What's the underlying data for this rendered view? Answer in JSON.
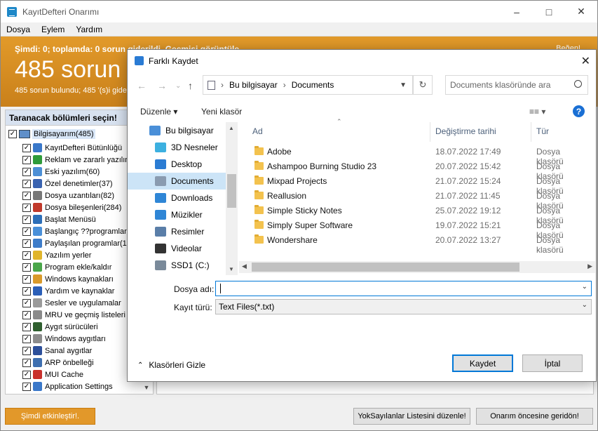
{
  "app": {
    "title": "KayıtDefteri Onarımı",
    "menu": [
      "Dosya",
      "Eylem",
      "Yardım"
    ],
    "banner": {
      "status_line": "Şimdi: 0; toplamda: 0 sorun giderildi. Geçmişi görüntüle",
      "big_text": "485 sorun",
      "sub_text": "485 sorun bulundu; 485 '(s)i gider",
      "like": "Beğen!"
    },
    "left_panel": {
      "heading": "Taranacak bölümleri seçin!",
      "root": "Bilgisayarım(485)",
      "items": [
        {
          "label": "KayıtDefteri Bütünlüğü",
          "color": "#3a78c9"
        },
        {
          "label": "Reklam ve zararlı yazılıml",
          "color": "#2e9b3a"
        },
        {
          "label": "Eski yazılım(60)",
          "color": "#4c8fd6"
        },
        {
          "label": "Özel denetimler(37)",
          "color": "#3a63b0"
        },
        {
          "label": "Dosya uzantıları(82)",
          "color": "#777777"
        },
        {
          "label": "Dosya bileşenleri(284)",
          "color": "#c0392b"
        },
        {
          "label": "Başlat Menüsü",
          "color": "#2d6fb8"
        },
        {
          "label": "Başlangıç ??programları(8",
          "color": "#4a90d9"
        },
        {
          "label": "Paylaşılan programlar(14",
          "color": "#3d7cc9"
        },
        {
          "label": "Yazılım yerler",
          "color": "#e0b52c"
        },
        {
          "label": "Program ekle/kaldır",
          "color": "#4aa64a"
        },
        {
          "label": "Windows kaynakları",
          "color": "#d99a2b"
        },
        {
          "label": "Yardım ve kaynaklar",
          "color": "#2b5fb8"
        },
        {
          "label": "Sesler ve uygulamalar",
          "color": "#9a9a9a"
        },
        {
          "label": "MRU ve geçmiş listeleri",
          "color": "#8a8a8a"
        },
        {
          "label": "Aygıt sürücüleri",
          "color": "#2f5f2f"
        },
        {
          "label": "Windows aygıtları",
          "color": "#8c8c8c"
        },
        {
          "label": "Sanal aygıtlar",
          "color": "#2c4f9a"
        },
        {
          "label": "ARP önbelleği",
          "color": "#3e6fb0"
        },
        {
          "label": "MUI Cache",
          "color": "#c9302c"
        },
        {
          "label": "Application Settings",
          "color": "#3a78c9"
        }
      ]
    },
    "buttons": {
      "fix_now": "Şimdi etkinleştir!.",
      "ignore_list": "YokSayılanlar Listesini düzenle!",
      "restore": "Onarım öncesine geridön!"
    }
  },
  "dialog": {
    "title": "Farklı Kaydet",
    "address": [
      "Bu bilgisayar",
      "Documents"
    ],
    "search_placeholder": "Documents klasöründe ara",
    "organize": "Düzenle",
    "new_folder": "Yeni klasör",
    "nav_items": [
      {
        "label": "Bu bilgisayar",
        "color": "#4a8fd8",
        "selected": false
      },
      {
        "label": "3D Nesneler",
        "color": "#3cb0e0",
        "selected": false
      },
      {
        "label": "Desktop",
        "color": "#2b7cd3",
        "selected": false
      },
      {
        "label": "Documents",
        "color": "#8a9bb0",
        "selected": true
      },
      {
        "label": "Downloads",
        "color": "#2f86d6",
        "selected": false
      },
      {
        "label": "Müzikler",
        "color": "#2f86d6",
        "selected": false
      },
      {
        "label": "Resimler",
        "color": "#5a7ea8",
        "selected": false
      },
      {
        "label": "Videolar",
        "color": "#333333",
        "selected": false
      },
      {
        "label": "SSD1 (C:)",
        "color": "#7a8a9a",
        "selected": false
      }
    ],
    "columns": {
      "name": "Ad",
      "date": "Değiştirme tarihi",
      "type": "Tür"
    },
    "files": [
      {
        "name": "Adobe",
        "date": "18.07.2022 17:49",
        "type": "Dosya klasörü"
      },
      {
        "name": "Ashampoo Burning Studio 23",
        "date": "20.07.2022 15:42",
        "type": "Dosya klasörü"
      },
      {
        "name": "Mixpad Projects",
        "date": "21.07.2022 15:24",
        "type": "Dosya klasörü"
      },
      {
        "name": "Reallusion",
        "date": "21.07.2022 11:45",
        "type": "Dosya klasörü"
      },
      {
        "name": "Simple Sticky Notes",
        "date": "25.07.2022 19:12",
        "type": "Dosya klasörü"
      },
      {
        "name": "Simply Super Software",
        "date": "19.07.2022 15:21",
        "type": "Dosya klasörü"
      },
      {
        "name": "Wondershare",
        "date": "20.07.2022 13:27",
        "type": "Dosya klasörü"
      }
    ],
    "filename_label": "Dosya adı:",
    "filename_value": "",
    "filetype_label": "Kayıt türü:",
    "filetype_value": "Text Files(*.txt)",
    "hide_folders": "Klasörleri Gizle",
    "save": "Kaydet",
    "cancel": "İptal"
  }
}
